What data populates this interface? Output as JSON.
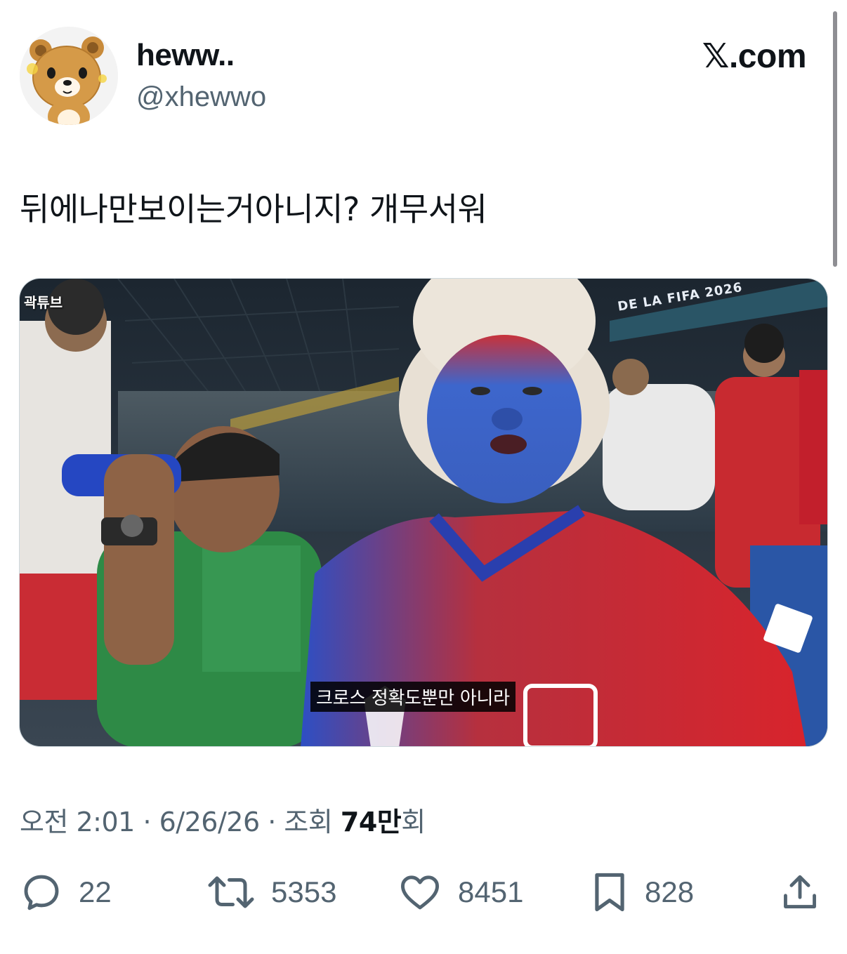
{
  "scrollbar": true,
  "header": {
    "display_name": "heww..",
    "handle": "@xhewwo",
    "brand": "𝕏.com"
  },
  "tweet": {
    "text": "뒤에나만보이는거아니지?  개무서워"
  },
  "media": {
    "watermark": "곽튜브",
    "banner_text": "DE LA FIFA 2026",
    "subtitle": "크로스 정확도뿐만 아니라"
  },
  "meta": {
    "time": "오전 2:01",
    "sep1": "·",
    "date": "6/26/26",
    "sep2": "·",
    "views_prefix": "조회",
    "views_num": "74만",
    "views_suffix": "회"
  },
  "actions": {
    "reply_count": "22",
    "retweet_count": "5353",
    "like_count": "8451",
    "bookmark_count": "828"
  },
  "colors": {
    "text": "#0f1419",
    "secondary": "#536471",
    "jersey_red": "#d8242c",
    "face_blue": "#3b63c9"
  }
}
